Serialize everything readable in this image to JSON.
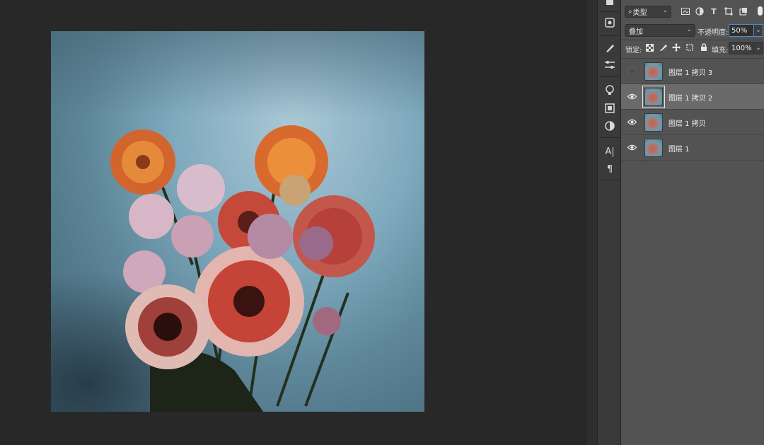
{
  "colors": {
    "panel_bg": "#535353",
    "selected_layer": "#6a6a6a",
    "focus_blue": "#4a90d9",
    "workspace": "#282828"
  },
  "toolbar_strip": {
    "icons": [
      "styles-icon",
      "brush-icon",
      "adjustments-icon",
      "lightbulb-icon",
      "swatches-icon",
      "contrast-icon",
      "character-icon",
      "paragraph-icon"
    ],
    "glyphs": {
      "character": "A|",
      "paragraph": "¶"
    }
  },
  "layers_panel": {
    "filter": {
      "selected": "类型",
      "search_symbol": "⌕"
    },
    "filter_icons": [
      "image-filter-icon",
      "adjustment-filter-icon",
      "text-filter-icon",
      "shape-filter-icon",
      "smartobject-filter-icon",
      "filter-toggle-icon"
    ],
    "text_filter_glyph": "T",
    "blend_mode": "叠加",
    "opacity_label": "不透明度:",
    "opacity_value": "50%",
    "lock_label": "锁定:",
    "fill_label": "填充:",
    "fill_value": "100%",
    "layers": [
      {
        "name": "图层 1 拷贝 3",
        "visible": false,
        "selected": false
      },
      {
        "name": "图层 1 拷贝 2",
        "visible": true,
        "selected": true
      },
      {
        "name": "图层 1 拷贝",
        "visible": true,
        "selected": false
      },
      {
        "name": "图层 1",
        "visible": true,
        "selected": false
      }
    ]
  }
}
